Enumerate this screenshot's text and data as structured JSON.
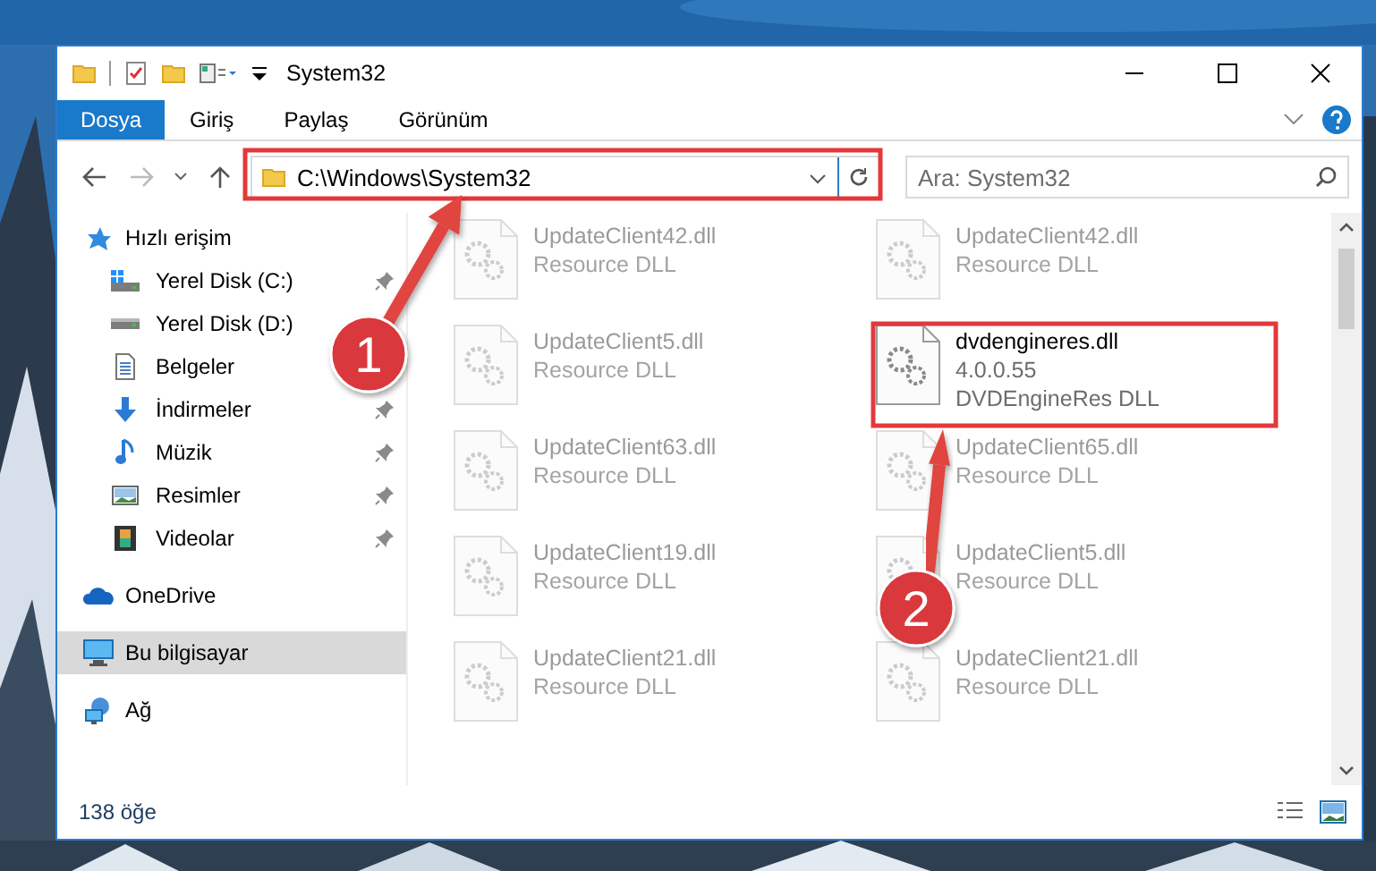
{
  "window": {
    "title": "System32"
  },
  "ribbon_tabs": [
    {
      "label": "Dosya",
      "selected": true
    },
    {
      "label": "Giriş",
      "selected": false
    },
    {
      "label": "Paylaş",
      "selected": false
    },
    {
      "label": "Görünüm",
      "selected": false
    }
  ],
  "address": {
    "path": "C:\\Windows\\System32"
  },
  "search": {
    "placeholder": "Ara: System32"
  },
  "sidebar": {
    "items": [
      {
        "label": "Hızlı erişim",
        "selected": false,
        "children": [
          {
            "label": "Yerel Disk (C:)",
            "pinned": true,
            "selected": false
          },
          {
            "label": "Yerel Disk (D:)",
            "pinned": false,
            "selected": false
          },
          {
            "label": "Belgeler",
            "selected": false
          },
          {
            "label": "İndirmeler",
            "pinned": true,
            "selected": false
          },
          {
            "label": "Müzik",
            "pinned": true,
            "selected": false
          },
          {
            "label": "Resimler",
            "pinned": true,
            "selected": false
          },
          {
            "label": "Videolar",
            "pinned": true,
            "selected": false
          }
        ]
      },
      {
        "label": "OneDrive",
        "selected": false
      },
      {
        "label": "Bu bilgisayar",
        "selected": true
      },
      {
        "label": "Ağ",
        "selected": false
      }
    ]
  },
  "files": [
    {
      "name": "UpdateClient42.dll",
      "description": "Resource DLL",
      "blurred": true
    },
    {
      "name": "UpdateClient42.dll",
      "description": "Resource DLL",
      "blurred": true
    },
    {
      "name": "UpdateClient5.dll",
      "description": "Resource DLL",
      "blurred": true
    },
    {
      "name": "dvdengineres.dll",
      "version": "4.0.0.55",
      "description": "DVDEngineRes DLL",
      "blurred": false
    },
    {
      "name": "UpdateClient63.dll",
      "description": "Resource DLL",
      "blurred": true
    },
    {
      "name": "UpdateClient65.dll",
      "description": "Resource DLL",
      "blurred": true
    },
    {
      "name": "UpdateClient19.dll",
      "description": "Resource DLL",
      "blurred": true
    },
    {
      "name": "UpdateClient5.dll",
      "description": "Resource DLL",
      "blurred": true
    },
    {
      "name": "UpdateClient21.dll",
      "description": "Resource DLL",
      "blurred": true
    },
    {
      "name": "UpdateClient21.dll",
      "description": "Resource DLL",
      "blurred": true
    }
  ],
  "status_bar": {
    "item_count": "138 öğe"
  },
  "annotations": [
    {
      "label": "1"
    },
    {
      "label": "2"
    }
  ]
}
